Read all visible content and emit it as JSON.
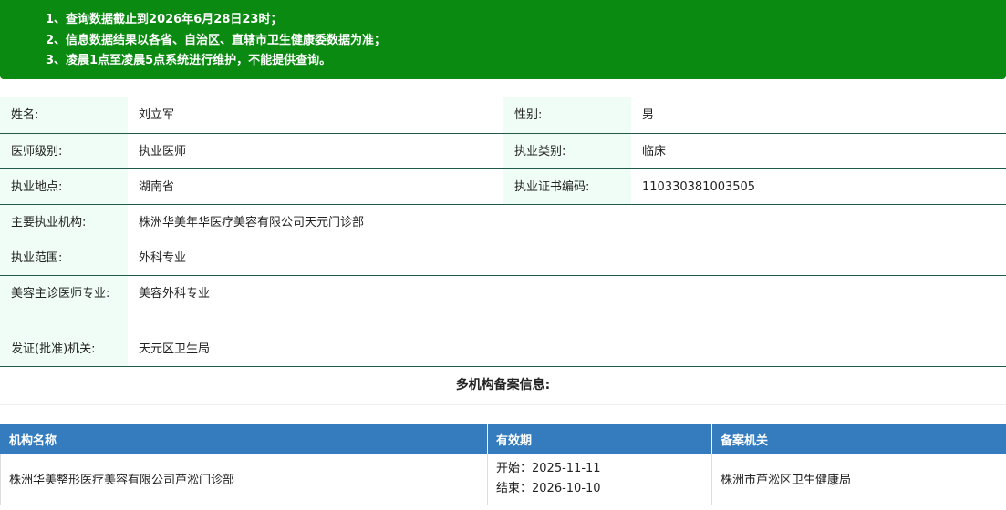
{
  "notice": {
    "line1": "1、查询数据截止到2026年6月28日23时；",
    "line2": "2、信息数据结果以各省、自治区、直辖市卫生健康委数据为准；",
    "line3_bold": "3、凌晨1点至凌晨5点",
    "line3_rest": "系统进行维护，不能提供查询。"
  },
  "info": {
    "name_label": "姓名:",
    "name_value": "刘立军",
    "gender_label": "性别:",
    "gender_value": "男",
    "level_label": "医师级别:",
    "level_value": "执业医师",
    "category_label": "执业类别:",
    "category_value": "临床",
    "location_label": "执业地点:",
    "location_value": "湖南省",
    "cert_label": "执业证书编码:",
    "cert_value": "110330381003505",
    "institution_label": "主要执业机构:",
    "institution_value": "株洲华美年华医疗美容有限公司天元门诊部",
    "scope_label": "执业范围:",
    "scope_value": "外科专业",
    "cosmetic_label": "美容主诊医师专业:",
    "cosmetic_value": "美容外科专业",
    "issuer_label": "发证(批准)机关:",
    "issuer_value": "天元区卫生局"
  },
  "multi": {
    "title": "多机构备案信息:"
  },
  "registration": {
    "headers": [
      "机构名称",
      "有效期",
      "备案机关"
    ],
    "rows": [
      {
        "institution": "株洲华美整形医疗美容有限公司芦淞门诊部",
        "start": "开始：2025-11-11",
        "end": "结束：2026-10-10",
        "authority": "株洲市芦淞区卫生健康局"
      }
    ]
  },
  "colors": {
    "notice_bg": "#0b8a12",
    "header_bg": "#347cbd",
    "label_bg": "#f0fdf7",
    "row_border": "#1f5a4a"
  }
}
